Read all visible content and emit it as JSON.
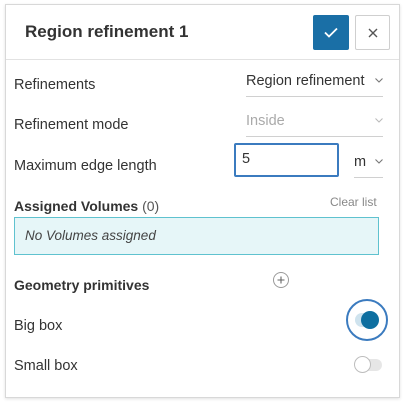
{
  "panel": {
    "title": "Region refinement 1",
    "apply_icon": "check-icon",
    "close_icon": "close-icon"
  },
  "fields": {
    "refinements": {
      "label": "Refinements",
      "value": "Region refinement"
    },
    "mode": {
      "label": "Refinement mode",
      "value": "Inside"
    },
    "max_edge": {
      "label": "Maximum edge length",
      "value": "5",
      "unit": "m"
    }
  },
  "assigned": {
    "label": "Assigned Volumes",
    "count": "(0)",
    "clear_label": "Clear list",
    "empty_text": "No Volumes assigned"
  },
  "primitives": {
    "label": "Geometry primitives",
    "items": [
      {
        "label": "Big box",
        "enabled": true
      },
      {
        "label": "Small box",
        "enabled": false
      }
    ]
  },
  "colors": {
    "primary": "#1a6fa6",
    "focus": "#3b7bbf",
    "info_bg": "#e6f6f8",
    "info_border": "#5fc2cf"
  }
}
